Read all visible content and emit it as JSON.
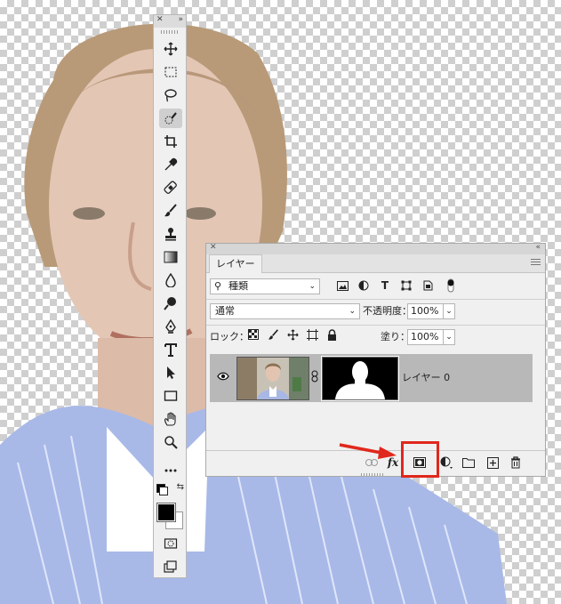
{
  "layers_panel": {
    "tab_label": "レイヤー",
    "filter": {
      "type_label": "種類"
    },
    "blend_mode": "通常",
    "opacity_label": "不透明度：",
    "opacity_value": "100%",
    "lock_label": "ロック：",
    "fill_label": "塗り：",
    "fill_value": "100%",
    "layer": {
      "name": "レイヤー 0",
      "visible": true
    }
  },
  "tools": [
    "move-icon",
    "marquee-icon",
    "lasso-icon",
    "quick-selection-icon",
    "crop-icon",
    "eyedropper-icon",
    "healing-brush-icon",
    "brush-icon",
    "clone-stamp-icon",
    "gradient-icon",
    "blur-icon",
    "dodge-icon",
    "pen-icon",
    "type-icon",
    "path-selection-icon",
    "rectangle-icon",
    "hand-icon",
    "zoom-icon",
    "more-tools-icon"
  ],
  "colors": {
    "highlight": "#e0281c",
    "foreground": "#000000",
    "background": "#ffffff"
  }
}
